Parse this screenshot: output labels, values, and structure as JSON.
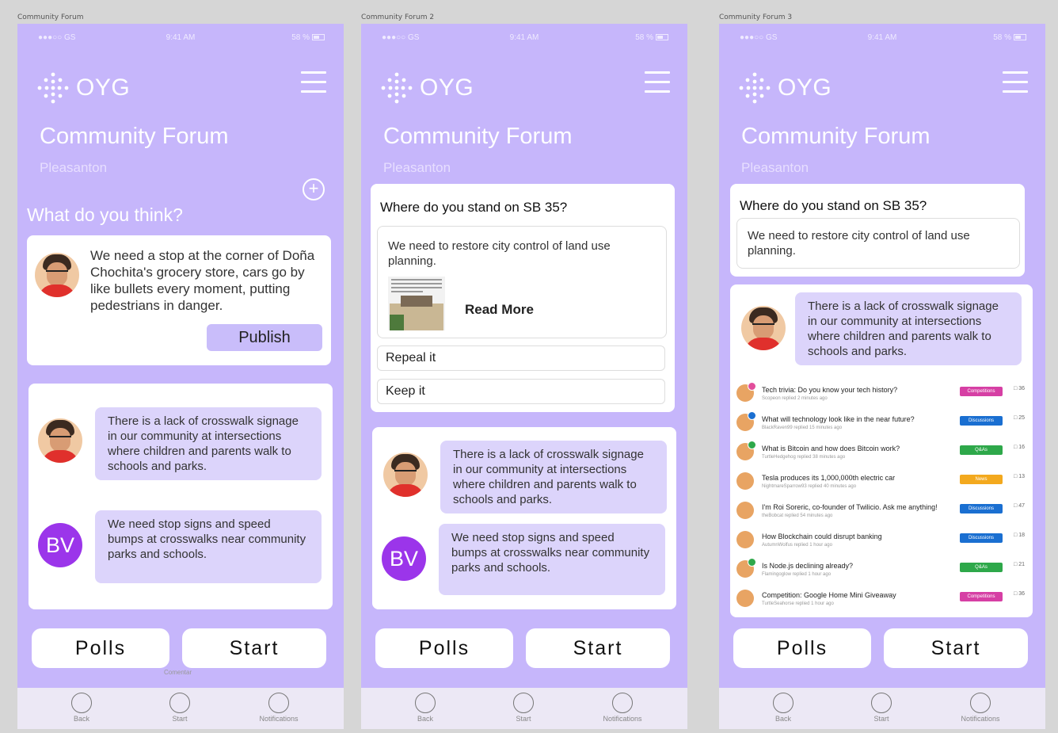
{
  "frames": [
    {
      "label": "Community Forum"
    },
    {
      "label": "Community Forum 2"
    },
    {
      "label": "Community Forum 3"
    }
  ],
  "status": {
    "carrier": "●●●○○ GS",
    "time": "9:41 AM",
    "battery": "58 %"
  },
  "header": {
    "logo": "OYG",
    "title": "Community Forum",
    "location": "Pleasanton"
  },
  "screen1": {
    "question": "What do you think?",
    "draft_text": "We need a stop at the corner of Doña Chochita's grocery store, cars go by like bullets every moment, putting pedestrians in danger.",
    "publish_label": "Publish",
    "comentar_label": "Comentar"
  },
  "poll": {
    "question": "Where do you stand on SB 35?",
    "statement": "We need to restore city control of land use planning.",
    "read_more": "Read More",
    "options": [
      "Repeal it",
      "Keep it"
    ]
  },
  "comments": [
    {
      "text": "There is a lack of crosswalk signage in our community at intersections where children and parents walk to schools and parks."
    },
    {
      "initials": "BV",
      "text": "We need stop signs and speed bumps at crosswalks near community parks and schools."
    }
  ],
  "feed": [
    {
      "title": "Tech trivia: Do you know your tech history?",
      "sub": "Scopeon replied 2 minutes ago",
      "tag": "Competitions",
      "tag_color": "#d63fa4",
      "count": "36",
      "dot": "#e24e9b"
    },
    {
      "title": "What will technology look like in the near future?",
      "sub": "BlackRaven99 replied 15 minutes ago",
      "tag": "Discussions",
      "tag_color": "#1a6fd1",
      "count": "25",
      "dot": "#1a6fd1"
    },
    {
      "title": "What is Bitcoin and how does Bitcoin work?",
      "sub": "TurtleHedgehog replied 38 minutes ago",
      "tag": "Q&As",
      "tag_color": "#2ea84a",
      "count": "16",
      "dot": "#2ea84a"
    },
    {
      "title": "Tesla produces its 1,000,000th electric car",
      "sub": "NightmareSparrow93 replied 40 minutes ago",
      "tag": "News",
      "tag_color": "#f3a91e",
      "count": "13",
      "dot": ""
    },
    {
      "title": "I'm Roi Soreric, co-founder of Twilicio. Ask me anything!",
      "sub": "theBobcat replied 54 minutes ago",
      "tag": "Discussions",
      "tag_color": "#1a6fd1",
      "count": "47",
      "dot": ""
    },
    {
      "title": "How Blockchain could disrupt banking",
      "sub": "AutumnWolfus replied 1 hour ago",
      "tag": "Discussions",
      "tag_color": "#1a6fd1",
      "count": "18",
      "dot": ""
    },
    {
      "title": "Is Node.js declining already?",
      "sub": "Flamingoglow replied 1 hour ago",
      "tag": "Q&As",
      "tag_color": "#2ea84a",
      "count": "21",
      "dot": "#2ea84a"
    },
    {
      "title": "Competition: Google Home Mini Giveaway",
      "sub": "TurtleSeahorse replied 1 hour ago",
      "tag": "Competitions",
      "tag_color": "#d63fa4",
      "count": "36",
      "dot": ""
    }
  ],
  "actions": {
    "polls": "Polls",
    "start": "Start"
  },
  "tabbar": {
    "back": "Back",
    "start": "Start",
    "notifications": "Notifications"
  },
  "colors": {
    "background": "#c6b6fb",
    "bubble": "#dcd4fb",
    "accent": "#9b35ea"
  }
}
